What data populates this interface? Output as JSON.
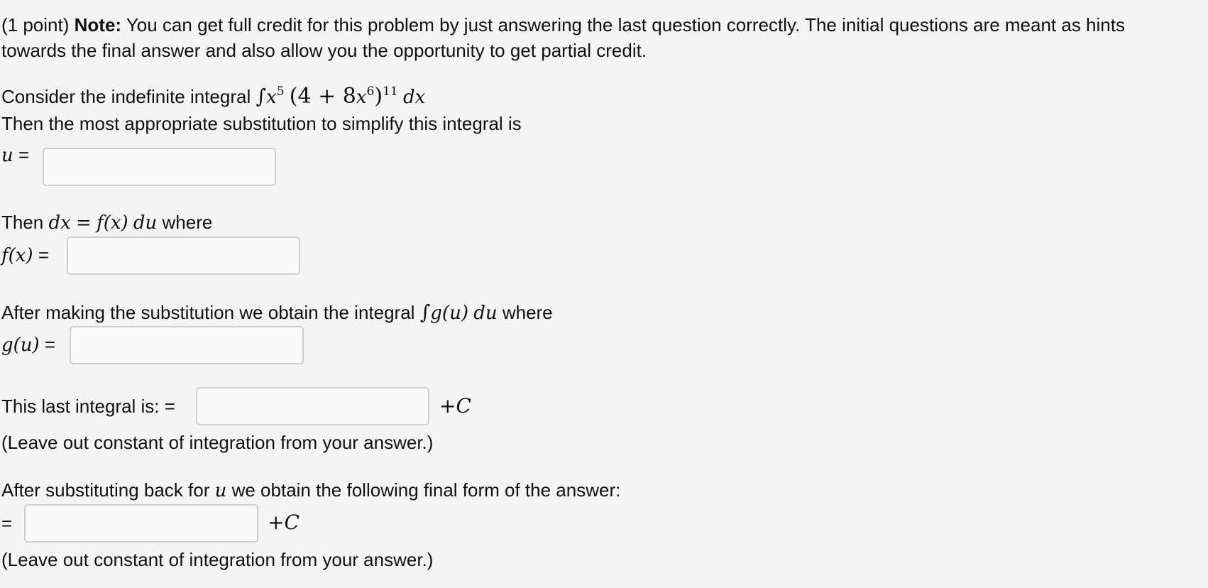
{
  "intro": {
    "points": "(1 point)",
    "note_label": "Note:",
    "note_text": "You can get full credit for this problem by just answering the last question correctly. The initial questions are meant as hints",
    "note_text_line2": "towards the final answer and also allow you the opportunity to get partial credit."
  },
  "q1": {
    "prompt": "Consider the indefinite integral",
    "integral": "∫",
    "x_base": "x",
    "x_exp": "5",
    "open": "(4 + 8",
    "x6_base": "x",
    "x6_exp": "6",
    "close": ")",
    "outer_exp": "11",
    "dx": "dx",
    "line2": "Then the most appropriate substitution to simplify this integral is",
    "label": "u",
    "equals": "=",
    "value": ""
  },
  "q2": {
    "then": "Then",
    "dx": "dx",
    "eq": "=",
    "fx": "f(x)",
    "du": "du",
    "where": "where",
    "label": "f(x)",
    "equals": "=",
    "value": ""
  },
  "q3": {
    "prompt": "After making the substitution we obtain the integral",
    "integral": "∫",
    "gu": "g(u)",
    "du": "du",
    "where": "where",
    "label": "g(u)",
    "equals": "=",
    "value": ""
  },
  "q4": {
    "prompt": "This last integral is: =",
    "plus": "+",
    "c": "C",
    "note": "(Leave out constant of integration from your answer.)",
    "value": ""
  },
  "q5": {
    "prompt_start": "After substituting back for",
    "u": "u",
    "prompt_end": "we obtain the following final form of the answer:",
    "equals": "=",
    "plus": "+",
    "c": "C",
    "note": "(Leave out constant of integration from your answer.)",
    "value": ""
  }
}
